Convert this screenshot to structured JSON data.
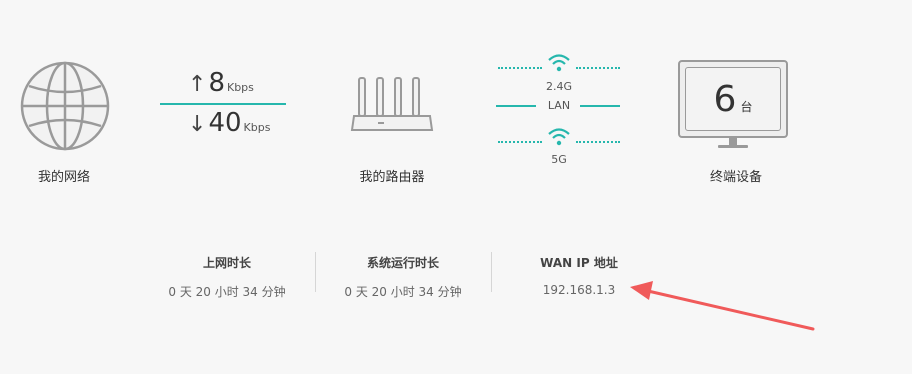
{
  "network": {
    "label": "我的网络",
    "icon": "globe-icon"
  },
  "speed": {
    "upload_value": "8",
    "upload_unit": "Kbps",
    "download_value": "40",
    "download_unit": "Kbps"
  },
  "router": {
    "label": "我的路由器",
    "icon": "router-icon"
  },
  "bands": {
    "wifi_24": "2.4G",
    "lan": "LAN",
    "wifi_5": "5G"
  },
  "devices": {
    "count": "6",
    "unit": "台",
    "label": "终端设备"
  },
  "stats": [
    {
      "title": "上网时长",
      "value": "0 天 20 小时 34 分钟"
    },
    {
      "title": "系统运行时长",
      "value": "0 天 20 小时 34 分钟"
    },
    {
      "title": "WAN IP 地址",
      "value": "192.168.1.3"
    }
  ],
  "colors": {
    "accent": "#26b7ad",
    "annotation_arrow": "#f05a5a",
    "background": "#f7f7f7"
  }
}
